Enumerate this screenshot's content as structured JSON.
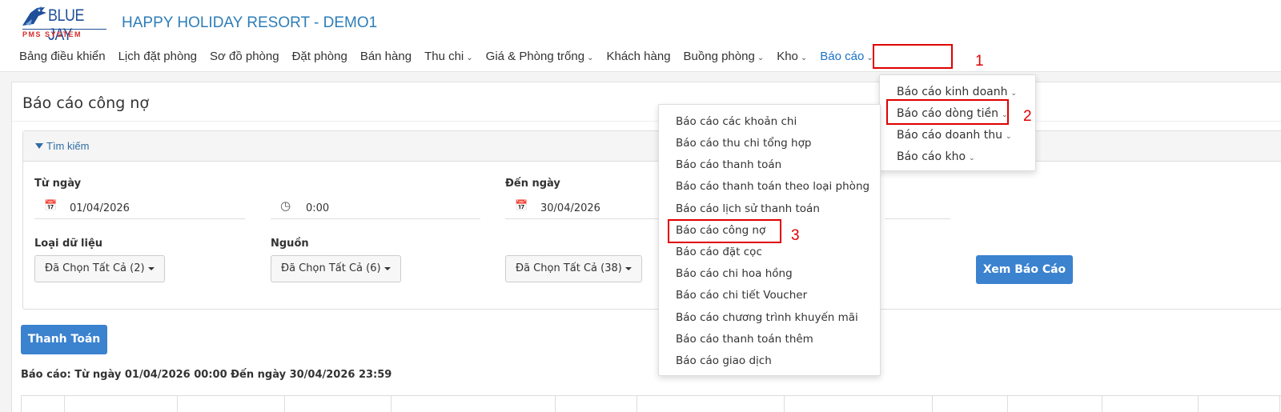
{
  "brand": {
    "logo_text": "BLUE JAY",
    "logo_sub": "PMS SYSTEM",
    "hotel_name": "HAPPY HOLIDAY RESORT - DEMO1"
  },
  "nav": [
    {
      "label": "Bảng điều khiển",
      "has_dropdown": false
    },
    {
      "label": "Lịch đặt phòng",
      "has_dropdown": false
    },
    {
      "label": "Sơ đồ phòng",
      "has_dropdown": false
    },
    {
      "label": "Đặt phòng",
      "has_dropdown": false
    },
    {
      "label": "Bán hàng",
      "has_dropdown": false
    },
    {
      "label": "Thu chi",
      "has_dropdown": true
    },
    {
      "label": "Giá & Phòng trống",
      "has_dropdown": true
    },
    {
      "label": "Khách hàng",
      "has_dropdown": false
    },
    {
      "label": "Buồng phòng",
      "has_dropdown": true
    },
    {
      "label": "Kho",
      "has_dropdown": true
    },
    {
      "label": "Báo cáo",
      "has_dropdown": true,
      "active": true
    }
  ],
  "steps": [
    "1",
    "2",
    "3"
  ],
  "page": {
    "title": "Báo cáo công nợ",
    "search_title": "Tìm kiếm",
    "from_date_label": "Từ ngày",
    "from_date": "01/04/2026",
    "from_time": "0:00",
    "to_date_label": "Đến ngày",
    "to_date": "30/04/2026",
    "data_type_label": "Loại dữ liệu",
    "data_type_value": "Đã Chọn Tất Cả (2)",
    "source_label": "Nguồn",
    "source_value": "Đã Chọn Tất Cả (6)",
    "third_value": "Đã Chọn Tất Cả (38)",
    "view_report_button": "Xem Báo Cáo",
    "pay_button": "Thanh Toán",
    "report_range": "Báo cáo: Từ ngày 01/04/2026 00:00 Đến ngày 30/04/2026 23:59"
  },
  "report_menu": [
    {
      "label": "Báo cáo kinh doanh"
    },
    {
      "label": "Báo cáo dòng tiền"
    },
    {
      "label": "Báo cáo doanh thu"
    },
    {
      "label": "Báo cáo kho"
    }
  ],
  "cashflow_menu": [
    "Báo cáo các khoản chi",
    "Báo cáo thu chi tổng hợp",
    "Báo cáo thanh toán",
    "Báo cáo thanh toán theo loại phòng",
    "Báo cáo lịch sử thanh toán",
    "Báo cáo công nợ",
    "Báo cáo đặt cọc",
    "Báo cáo chi hoa hồng",
    "Báo cáo chi tiết Voucher",
    "Báo cáo chương trình khuyến mãi",
    "Báo cáo thanh toán thêm",
    "Báo cáo giao dịch"
  ],
  "colors": {
    "accent": "#1a73c8",
    "primary_button": "#3b82cf",
    "highlight": "#e00000"
  }
}
